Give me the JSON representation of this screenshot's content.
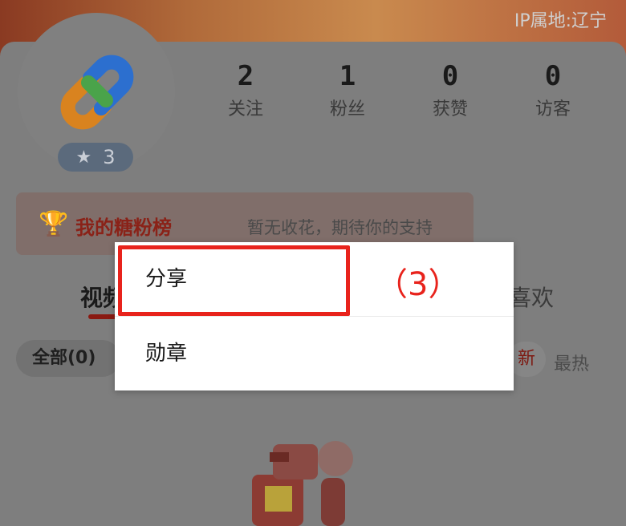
{
  "header": {
    "ip_location": "IP属地:辽宁"
  },
  "profile": {
    "level": "3",
    "level_icon": "star-icon"
  },
  "stats": [
    {
      "value": "2",
      "label": "关注"
    },
    {
      "value": "1",
      "label": "粉丝"
    },
    {
      "value": "0",
      "label": "获赞"
    },
    {
      "value": "0",
      "label": "访客"
    }
  ],
  "fan_board": {
    "title": "我的糖粉榜",
    "description": "暂无收花，期待你的支持"
  },
  "tabs": {
    "video": "视频",
    "like": "喜欢"
  },
  "filters": {
    "all": "全部(0)",
    "newest": "新",
    "hottest": "最热"
  },
  "menu": {
    "items": [
      {
        "label": "分享"
      },
      {
        "label": "勋章"
      }
    ]
  },
  "annotation": {
    "label": "（3）"
  },
  "colors": {
    "highlight": "#e8231c",
    "accent": "#8a2218"
  }
}
